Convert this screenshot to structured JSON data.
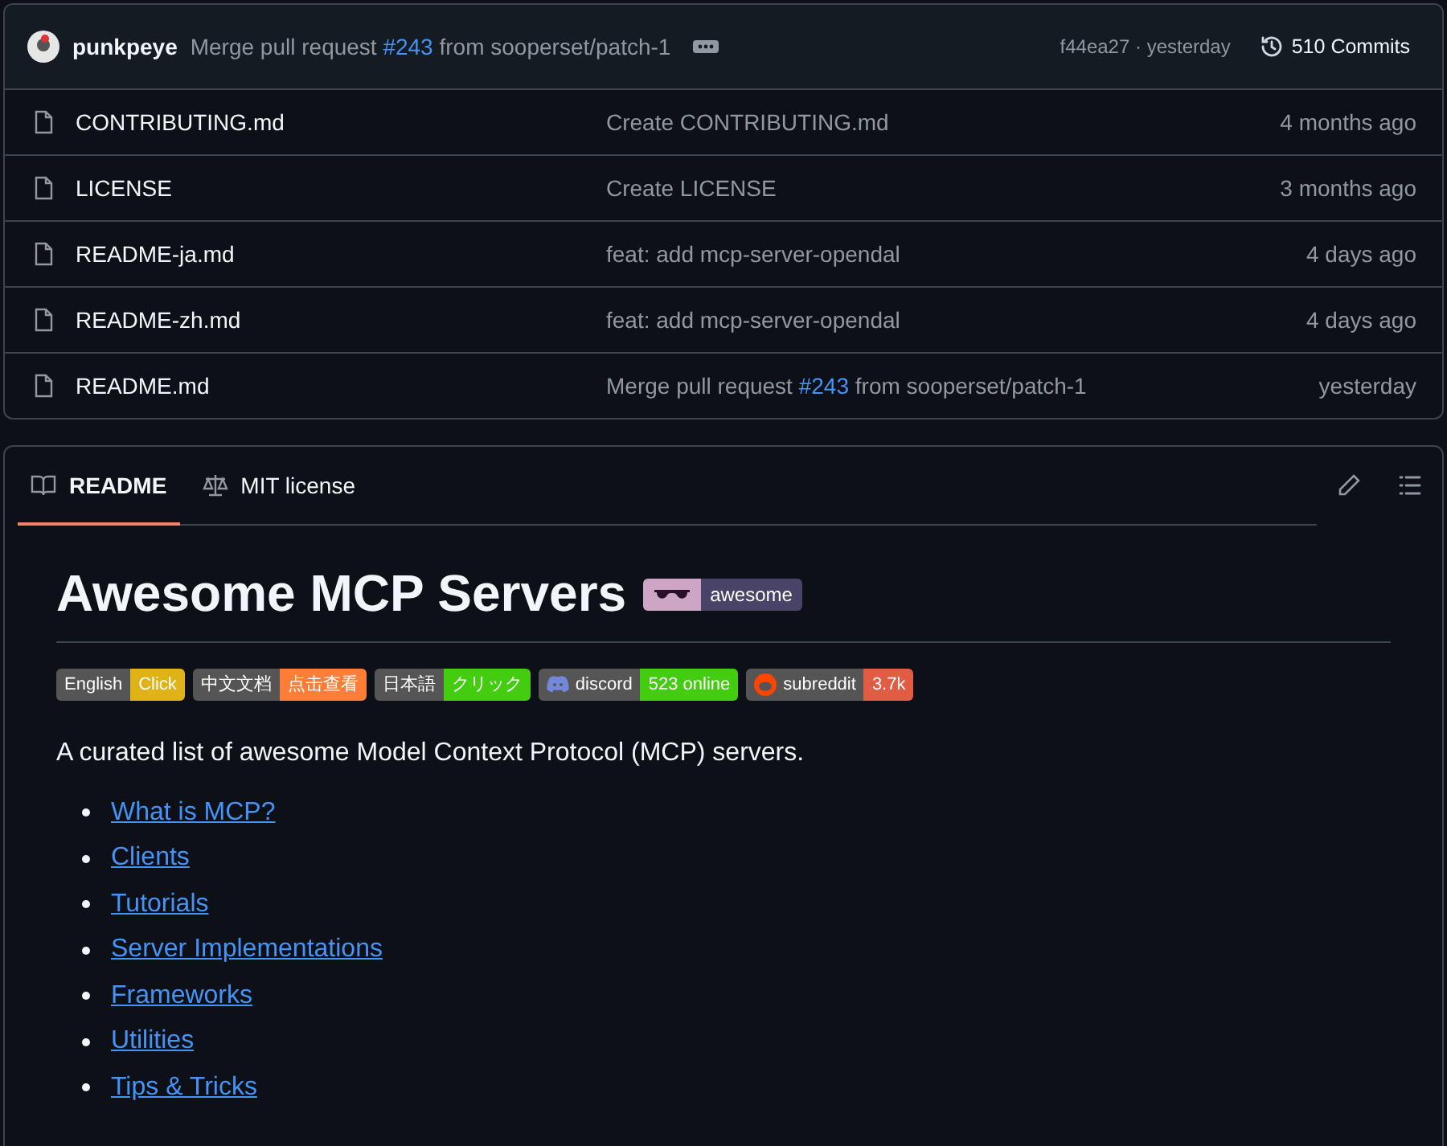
{
  "latest_commit": {
    "author": "punkpeye",
    "message": {
      "before": "Merge pull request",
      "link": "#243",
      "after": "from sooperset/patch-1"
    },
    "hash": "f44ea27 · yesterday",
    "commits": "510 Commits"
  },
  "files": [
    {
      "name": "CONTRIBUTING.md",
      "message": {
        "before": "Create CONTRIBUTING.md"
      },
      "time": "4 months ago"
    },
    {
      "name": "LICENSE",
      "message": {
        "before": "Create LICENSE"
      },
      "time": "3 months ago"
    },
    {
      "name": "README-ja.md",
      "message": {
        "before": "feat: add mcp-server-opendal"
      },
      "time": "4 days ago"
    },
    {
      "name": "README-zh.md",
      "message": {
        "before": "feat: add mcp-server-opendal"
      },
      "time": "4 days ago"
    },
    {
      "name": "README.md",
      "message": {
        "before": "Merge pull request",
        "link": "#243",
        "after": "from sooperset/patch-1"
      },
      "time": "yesterday"
    }
  ],
  "readme_tabs": [
    {
      "label": "README",
      "kind": "book",
      "selected": true
    },
    {
      "label": "MIT license",
      "kind": "scale",
      "selected": false
    }
  ],
  "readme": {
    "title": "Awesome MCP Servers",
    "title_badge": {
      "message": "awesome"
    },
    "badges": [
      {
        "kind": "text",
        "label": "English",
        "message": "Click",
        "color": "#dfb317"
      },
      {
        "kind": "text",
        "label": "中文文档",
        "message": "点击查看",
        "color": "#fe7d37"
      },
      {
        "kind": "text",
        "label": "日本語",
        "message": "クリック",
        "color": "#4c1"
      },
      {
        "kind": "discord",
        "label": "discord",
        "message": "523 online",
        "color": "#44cc11"
      },
      {
        "kind": "reddit",
        "label": "subreddit",
        "message": "3.7k",
        "color": "#e05d44"
      }
    ],
    "intro": "A curated list of awesome Model Context Protocol (MCP) servers.",
    "toc": [
      "What is MCP?",
      "Clients",
      "Tutorials",
      "Server Implementations",
      "Frameworks",
      "Utilities",
      "Tips & Tricks"
    ]
  }
}
